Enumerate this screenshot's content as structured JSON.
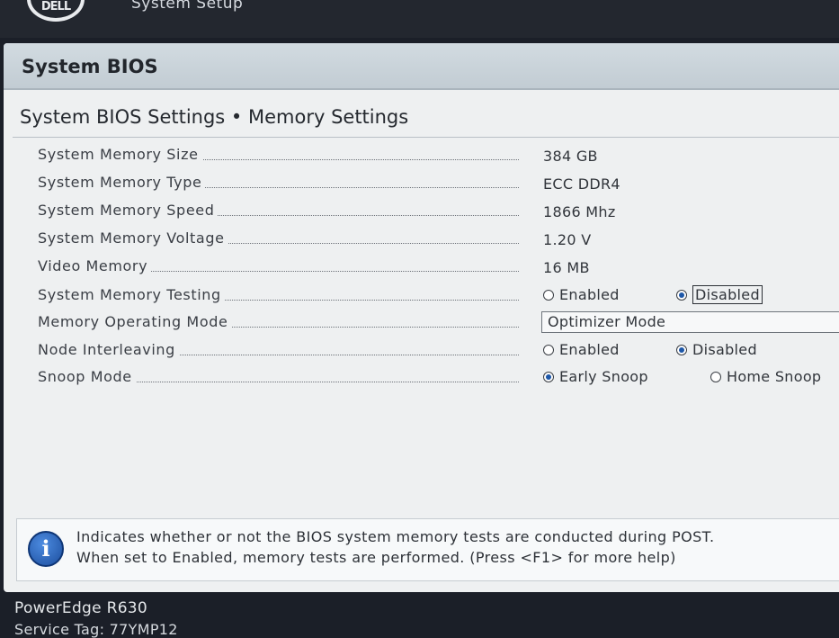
{
  "app": {
    "logo_text": "DELL",
    "title": "System Setup"
  },
  "panel": {
    "title": "System BIOS",
    "section_title": "System BIOS Settings • Memory Settings"
  },
  "settings": [
    {
      "label": "System Memory Size",
      "value": "384 GB"
    },
    {
      "label": "System Memory Type",
      "value": "ECC DDR4"
    },
    {
      "label": "System Memory Speed",
      "value": "1866 Mhz"
    },
    {
      "label": "System Memory Voltage",
      "value": "1.20 V"
    },
    {
      "label": "Video Memory",
      "value": "16 MB"
    },
    {
      "label": "System Memory Testing",
      "options": [
        "Enabled",
        "Disabled"
      ],
      "selected": "Disabled"
    },
    {
      "label": "Memory Operating Mode",
      "value": "Optimizer Mode"
    },
    {
      "label": "Node Interleaving",
      "options": [
        "Enabled",
        "Disabled"
      ],
      "selected": "Disabled"
    },
    {
      "label": "Snoop Mode",
      "options": [
        "Early Snoop",
        "Home Snoop"
      ],
      "selected": "Early Snoop"
    }
  ],
  "help": {
    "line1": "Indicates whether or not the BIOS system memory tests are conducted during POST.",
    "line2": "When set to Enabled, memory tests are performed. (Press <F1> for more help)"
  },
  "footer": {
    "model": "PowerEdge R630",
    "service_tag": "Service Tag: 77YMP12"
  },
  "colors": {
    "accent": "#1d57a8",
    "header": "#c8d2d9",
    "frame": "#1b1f28"
  }
}
